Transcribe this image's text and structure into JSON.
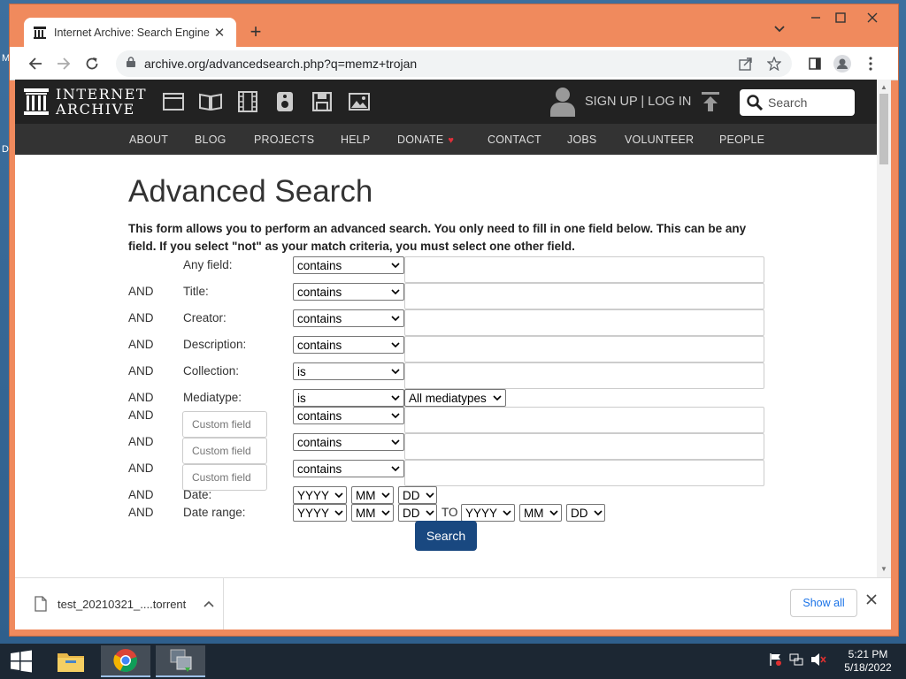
{
  "desktop": {
    "edge_text_a": "M",
    "edge_text_b": "D"
  },
  "browser": {
    "tab_title": "Internet Archive: Search Engine",
    "new_tab": "+",
    "url": "archive.org/advancedsearch.php?q=memz+trojan",
    "accent": "#f08a5d"
  },
  "ia": {
    "logo_line1": "INTERNET",
    "logo_line2": "ARCHIVE",
    "signup": "SIGN UP | LOG IN",
    "search_placeholder": "Search",
    "nav": [
      "ABOUT",
      "BLOG",
      "PROJECTS",
      "HELP",
      "DONATE",
      "CONTACT",
      "JOBS",
      "VOLUNTEER",
      "PEOPLE"
    ],
    "media_icons": [
      "web-icon",
      "texts-icon",
      "video-icon",
      "audio-icon",
      "software-icon",
      "images-icon"
    ]
  },
  "form": {
    "title": "Advanced Search",
    "intro": "This form allows you to perform an advanced search. You only need to fill in one field below. This can be any field. If you select \"not\" as your match criteria, you must select one other field.",
    "and": "AND",
    "rows": [
      {
        "label": "Any field:",
        "match": "contains"
      },
      {
        "label": "Title:",
        "match": "contains"
      },
      {
        "label": "Creator:",
        "match": "contains"
      },
      {
        "label": "Description:",
        "match": "contains"
      },
      {
        "label": "Collection:",
        "match": "is"
      }
    ],
    "mediatype": {
      "label": "Mediatype:",
      "match": "is",
      "value": "All mediatypes"
    },
    "custom_fields": [
      {
        "placeholder": "Custom field",
        "match": "contains"
      },
      {
        "placeholder": "Custom field",
        "match": "contains"
      },
      {
        "placeholder": "Custom field",
        "match": "contains"
      }
    ],
    "date": {
      "label": "Date:",
      "year": "YYYY",
      "month": "MM",
      "day": "DD"
    },
    "date_range": {
      "label": "Date range:",
      "to": "TO",
      "year": "YYYY",
      "month": "MM",
      "day": "DD"
    },
    "search_button": "Search"
  },
  "downloads": {
    "file": "test_20210321_....torrent",
    "show_all": "Show all"
  },
  "taskbar": {
    "time": "5:21 PM",
    "date": "5/18/2022"
  }
}
